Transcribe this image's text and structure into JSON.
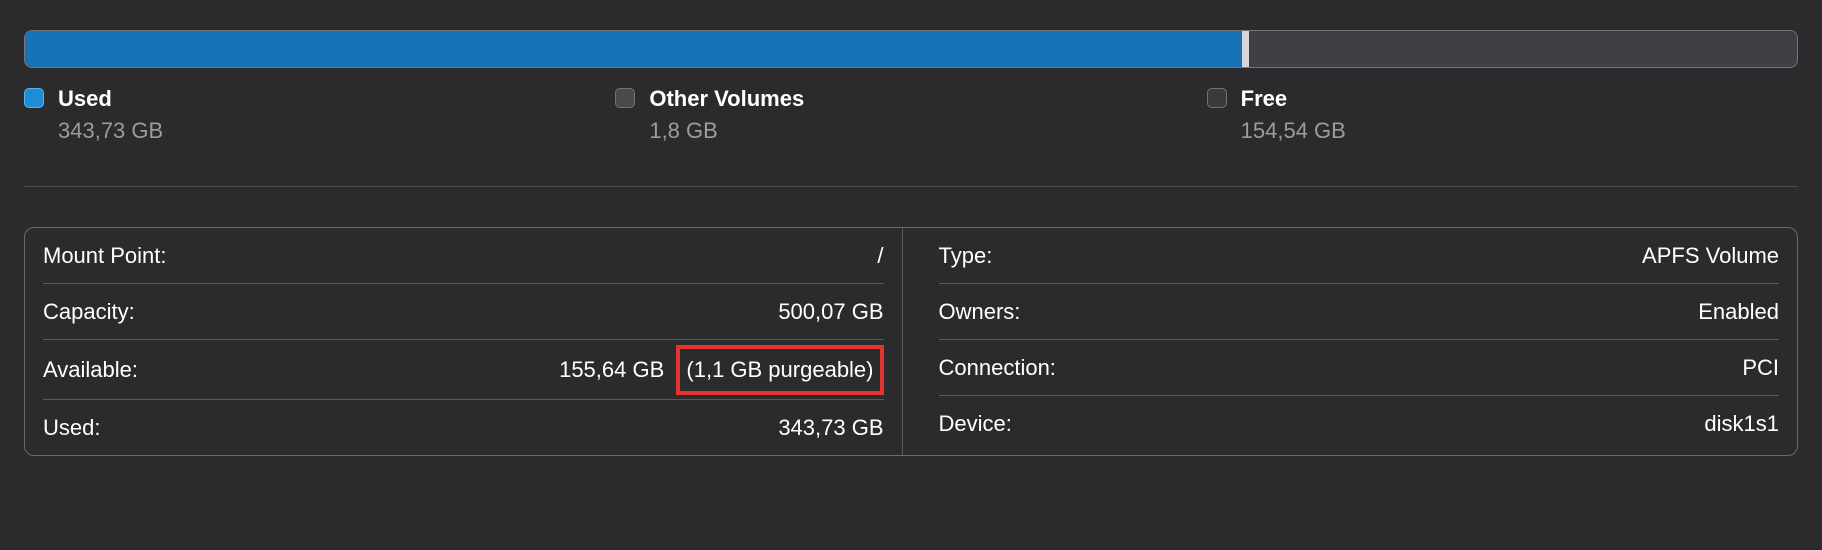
{
  "usage_bar": {
    "used_pct": 68.7,
    "other_pct": 0.4,
    "free_pct": 30.9
  },
  "legend": {
    "used": {
      "label": "Used",
      "value": "343,73 GB"
    },
    "other": {
      "label": "Other Volumes",
      "value": "1,8 GB"
    },
    "free": {
      "label": "Free",
      "value": "154,54 GB"
    }
  },
  "details_left": {
    "mount_point": {
      "label": "Mount Point:",
      "value": "/"
    },
    "capacity": {
      "label": "Capacity:",
      "value": "500,07 GB"
    },
    "available": {
      "label": "Available:",
      "value": "155,64 GB",
      "purgeable": "(1,1 GB purgeable)"
    },
    "used": {
      "label": "Used:",
      "value": "343,73 GB"
    }
  },
  "details_right": {
    "type": {
      "label": "Type:",
      "value": "APFS Volume"
    },
    "owners": {
      "label": "Owners:",
      "value": "Enabled"
    },
    "connection": {
      "label": "Connection:",
      "value": "PCI"
    },
    "device": {
      "label": "Device:",
      "value": "disk1s1"
    }
  }
}
